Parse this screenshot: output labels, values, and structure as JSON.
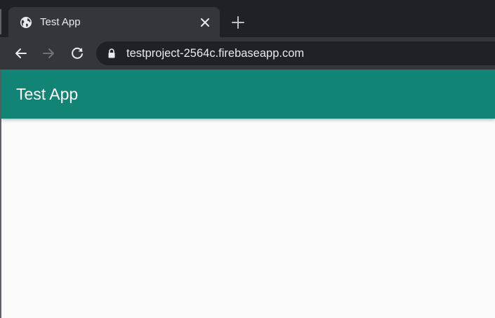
{
  "browser": {
    "tab": {
      "title": "Test App",
      "favicon": "globe-icon"
    },
    "new_tab_icon": "plus-icon",
    "close_icon": "close-icon",
    "toolbar": {
      "back_icon": "arrow-left-icon",
      "forward_icon": "arrow-right-icon",
      "reload_icon": "reload-icon",
      "lock_icon": "lock-icon",
      "url": "testproject-2564c.firebaseapp.com"
    }
  },
  "app": {
    "title": "Test App",
    "colors": {
      "app_bar": "#128475",
      "page_background": "#fafafa"
    }
  }
}
